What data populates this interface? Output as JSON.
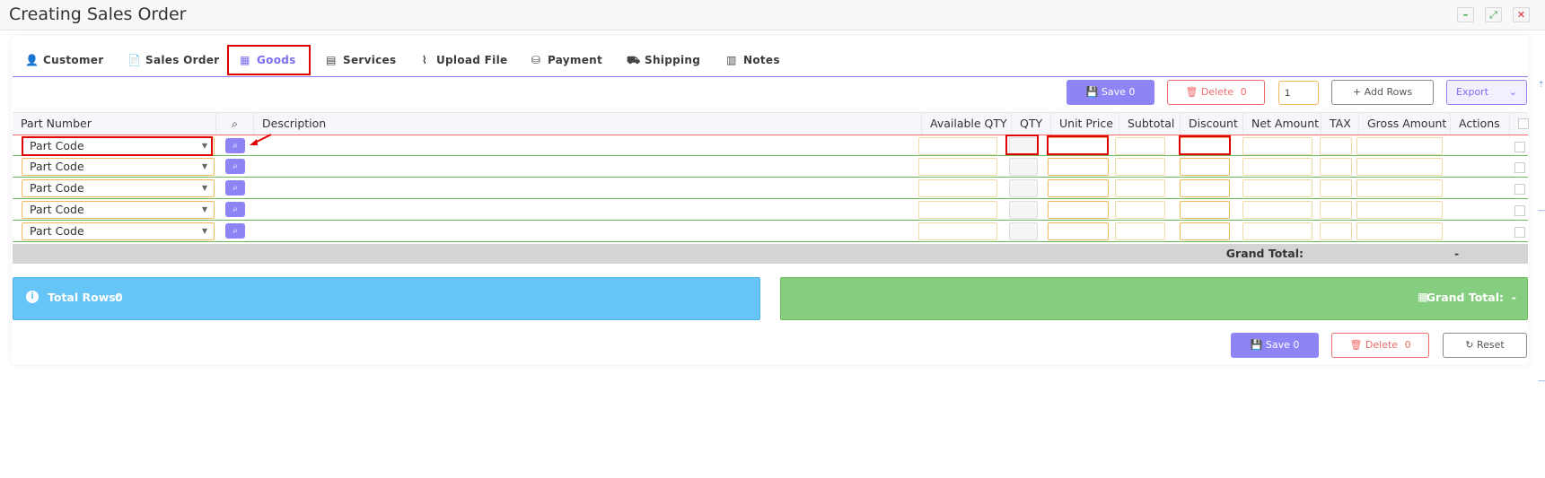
{
  "window": {
    "title": "Creating Sales Order",
    "controls": [
      "–",
      "⤢",
      "✕"
    ]
  },
  "tabs": [
    {
      "label": "Customer",
      "icon": "user-icon"
    },
    {
      "label": "Sales Order",
      "icon": "document-dollar-icon"
    },
    {
      "label": "Goods",
      "icon": "boxes-icon",
      "active": true
    },
    {
      "label": "Services",
      "icon": "file-icon"
    },
    {
      "label": "Upload File",
      "icon": "paperclip-icon"
    },
    {
      "label": "Payment",
      "icon": "money-bag-icon"
    },
    {
      "label": "Shipping",
      "icon": "truck-icon"
    },
    {
      "label": "Notes",
      "icon": "notebook-icon"
    }
  ],
  "toolbar": {
    "save_label": "Save",
    "save_count": "0",
    "delete_label": "Delete",
    "delete_count": "0",
    "rows_value": "1",
    "add_rows_label": "Add Rows",
    "export_label": "Export"
  },
  "table": {
    "headers": [
      "Part Number",
      "Description",
      "Available QTY",
      "QTY",
      "Unit Price",
      "Subtotal",
      "Discount",
      "Net Amount",
      "TAX",
      "Gross Amount",
      "Actions"
    ],
    "rows": [
      {
        "part_code": "Part Code"
      },
      {
        "part_code": "Part Code"
      },
      {
        "part_code": "Part Code"
      },
      {
        "part_code": "Part Code"
      },
      {
        "part_code": "Part Code"
      }
    ],
    "grand_total_label": "Grand Total:",
    "grand_total_value": "-"
  },
  "summary": {
    "total_rows_label": "Total Rows:",
    "total_rows_value": "0",
    "grand_total_label": "Grand Total:",
    "grand_total_value": "-"
  },
  "footer": {
    "save_label": "Save",
    "save_count": "0",
    "delete_label": "Delete",
    "delete_count": "0",
    "reset_label": "Reset"
  },
  "colors": {
    "accent": "#8e84f6",
    "danger": "#ef6b6b",
    "info_panel": "#67c4f6",
    "success_panel": "#86ce7f",
    "highlight": "#e00000"
  }
}
